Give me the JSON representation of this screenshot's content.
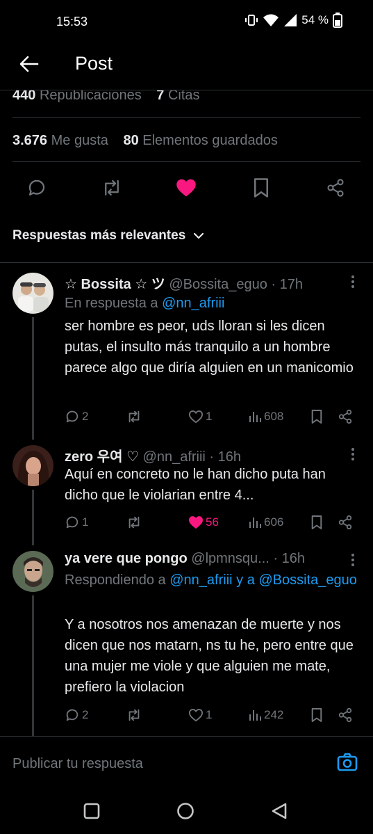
{
  "status_bar": {
    "time": "15:53",
    "battery": "54 %"
  },
  "header": {
    "title": "Post"
  },
  "stats": {
    "reposts_count": "440",
    "reposts_label": "Republicaciones",
    "quotes_count": "7",
    "quotes_label": "Citas",
    "likes_count": "3.676",
    "likes_label": "Me gusta",
    "bookmarks_count": "80",
    "bookmarks_label": "Elementos guardados"
  },
  "sort": {
    "label": "Respuestas más relevantes"
  },
  "replies": [
    {
      "name": "☆ Bossita ☆ ツ",
      "handle": "@Bossita_eguo · 17h",
      "reply_prefix": "En respuesta a ",
      "reply_to": "@nn_afriii",
      "text": "ser hombre es peor, uds lloran si les dicen putas, el insulto más tranquilo a un hombre parece algo que diría alguien en un manicomio",
      "comments": "2",
      "reposts": "",
      "likes": "1",
      "views": "608"
    },
    {
      "name": "zero 우여 ♡",
      "handle": "@nn_afriii · 16h",
      "text": "Aquí en concreto no le han dicho puta han dicho que le violarian entre 4...",
      "comments": "1",
      "reposts": "",
      "likes": "56",
      "views": "606"
    },
    {
      "name": "ya vere que pongo",
      "handle": "@lpmnsqu... · 16h",
      "reply_prefix": "Respondiendo a ",
      "reply_to": "@nn_afriii y a @Bossita_eguo",
      "text": "Y a nosotros nos amenazan de muerte y nos dicen que nos matarn, ns tu he, pero entre que una mujer me viole y que alguien me mate, prefiero la violacion",
      "comments": "2",
      "reposts": "",
      "likes": "1",
      "views": "242"
    }
  ],
  "compose": {
    "placeholder": "Publicar tu respuesta"
  },
  "colors": {
    "accent": "#1d9bf0",
    "like": "#f91880",
    "muted": "#71767b"
  }
}
